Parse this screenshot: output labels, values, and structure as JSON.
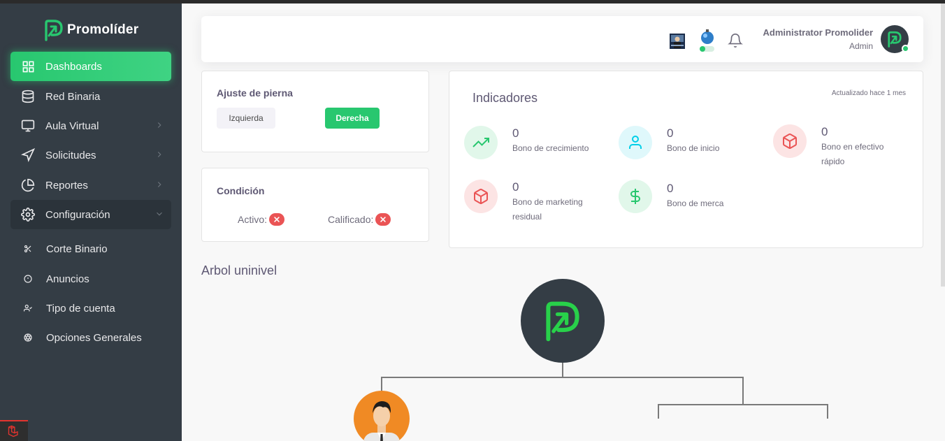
{
  "brand": {
    "name": "Promolíder",
    "accent": "#28c76f",
    "sidebar_bg": "#343d45"
  },
  "sidebar": {
    "items": [
      {
        "label": "Dashboards",
        "icon": "grid-icon",
        "active": true
      },
      {
        "label": "Red Binaria",
        "icon": "database-icon"
      },
      {
        "label": "Aula Virtual",
        "icon": "monitor-icon",
        "chevron": "chevron-right-icon"
      },
      {
        "label": "Solicitudes",
        "icon": "send-icon",
        "chevron": "chevron-right-icon"
      },
      {
        "label": "Reportes",
        "icon": "pie-chart-icon",
        "chevron": "chevron-right-icon"
      },
      {
        "label": "Configuración",
        "icon": "settings-icon",
        "chevron": "chevron-down-icon",
        "open": true
      }
    ],
    "sub_items": [
      {
        "label": "Corte Binario",
        "icon": "scissors-icon"
      },
      {
        "label": "Anuncios",
        "icon": "alert-circle-icon"
      },
      {
        "label": "Tipo de cuenta",
        "icon": "user-check-icon"
      },
      {
        "label": "Opciones Generales",
        "icon": "aperture-icon"
      }
    ]
  },
  "header": {
    "user_name": "Administrator Promolider",
    "user_role": "Admin",
    "icons": [
      "country-flag-icon",
      "bomb-icon",
      "bell-icon"
    ]
  },
  "leg_card": {
    "title": "Ajuste de pierna",
    "left_label": "Izquierda",
    "right_label": "Derecha",
    "selected": "Derecha"
  },
  "condition_card": {
    "title": "Condición",
    "active_label": "Activo:",
    "qualified_label": "Calificado:",
    "active": false,
    "qualified": false
  },
  "indicators": {
    "title": "Indicadores",
    "updated": "Actualizado hace 1 mes",
    "stats": [
      {
        "value": "0",
        "label": "Bono de crecimiento",
        "icon": "trending-up-icon",
        "color": "#28c76f"
      },
      {
        "value": "0",
        "label": "Bono de inicio",
        "icon": "user-icon",
        "color": "#00cfe8"
      },
      {
        "value": "0",
        "label": "Bono en efectivo rápido",
        "icon": "box-icon",
        "color": "#ea5455"
      },
      {
        "value": "0",
        "label": "Bono de marketing residual",
        "icon": "box-icon",
        "color": "#ea5455"
      },
      {
        "value": "0",
        "label": "Bono de merca",
        "icon": "dollar-sign-icon",
        "color": "#28c76f"
      }
    ]
  },
  "tree": {
    "title": "Arbol uninivel"
  }
}
